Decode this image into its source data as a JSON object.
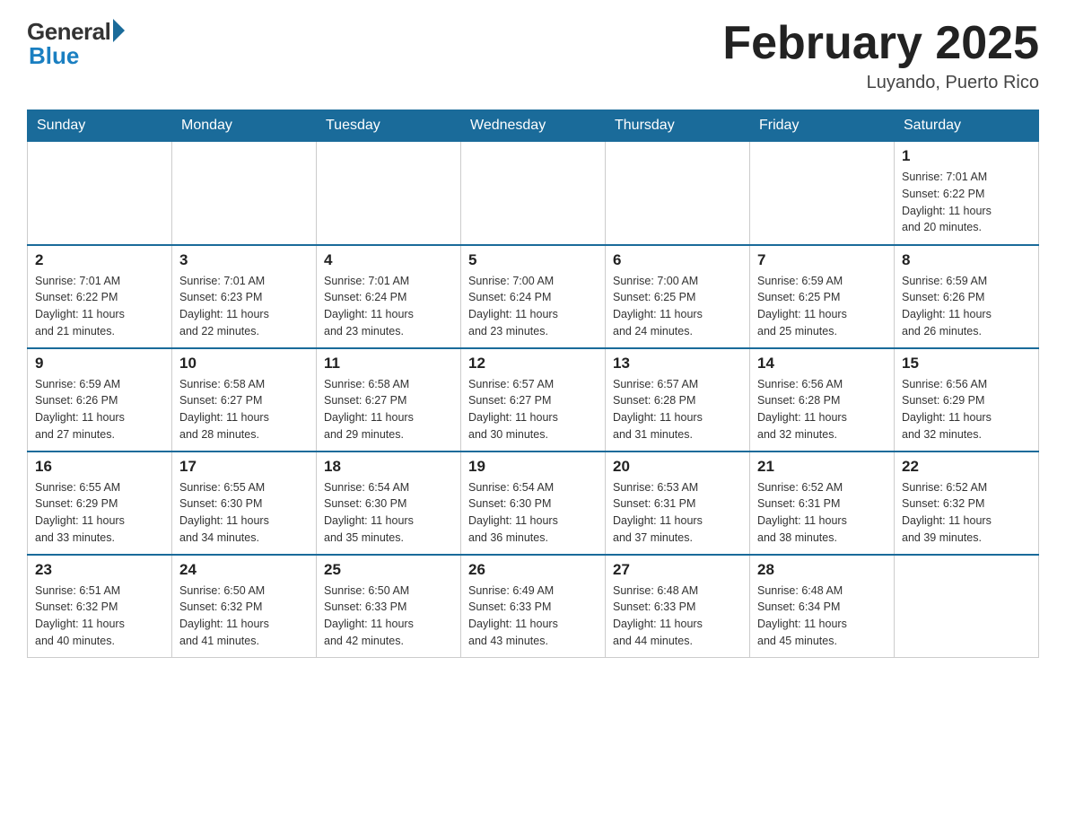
{
  "header": {
    "logo_general": "General",
    "logo_blue": "Blue",
    "month_title": "February 2025",
    "location": "Luyando, Puerto Rico"
  },
  "days_of_week": [
    "Sunday",
    "Monday",
    "Tuesday",
    "Wednesday",
    "Thursday",
    "Friday",
    "Saturday"
  ],
  "weeks": [
    [
      {
        "day": "",
        "info": ""
      },
      {
        "day": "",
        "info": ""
      },
      {
        "day": "",
        "info": ""
      },
      {
        "day": "",
        "info": ""
      },
      {
        "day": "",
        "info": ""
      },
      {
        "day": "",
        "info": ""
      },
      {
        "day": "1",
        "info": "Sunrise: 7:01 AM\nSunset: 6:22 PM\nDaylight: 11 hours\nand 20 minutes."
      }
    ],
    [
      {
        "day": "2",
        "info": "Sunrise: 7:01 AM\nSunset: 6:22 PM\nDaylight: 11 hours\nand 21 minutes."
      },
      {
        "day": "3",
        "info": "Sunrise: 7:01 AM\nSunset: 6:23 PM\nDaylight: 11 hours\nand 22 minutes."
      },
      {
        "day": "4",
        "info": "Sunrise: 7:01 AM\nSunset: 6:24 PM\nDaylight: 11 hours\nand 23 minutes."
      },
      {
        "day": "5",
        "info": "Sunrise: 7:00 AM\nSunset: 6:24 PM\nDaylight: 11 hours\nand 23 minutes."
      },
      {
        "day": "6",
        "info": "Sunrise: 7:00 AM\nSunset: 6:25 PM\nDaylight: 11 hours\nand 24 minutes."
      },
      {
        "day": "7",
        "info": "Sunrise: 6:59 AM\nSunset: 6:25 PM\nDaylight: 11 hours\nand 25 minutes."
      },
      {
        "day": "8",
        "info": "Sunrise: 6:59 AM\nSunset: 6:26 PM\nDaylight: 11 hours\nand 26 minutes."
      }
    ],
    [
      {
        "day": "9",
        "info": "Sunrise: 6:59 AM\nSunset: 6:26 PM\nDaylight: 11 hours\nand 27 minutes."
      },
      {
        "day": "10",
        "info": "Sunrise: 6:58 AM\nSunset: 6:27 PM\nDaylight: 11 hours\nand 28 minutes."
      },
      {
        "day": "11",
        "info": "Sunrise: 6:58 AM\nSunset: 6:27 PM\nDaylight: 11 hours\nand 29 minutes."
      },
      {
        "day": "12",
        "info": "Sunrise: 6:57 AM\nSunset: 6:27 PM\nDaylight: 11 hours\nand 30 minutes."
      },
      {
        "day": "13",
        "info": "Sunrise: 6:57 AM\nSunset: 6:28 PM\nDaylight: 11 hours\nand 31 minutes."
      },
      {
        "day": "14",
        "info": "Sunrise: 6:56 AM\nSunset: 6:28 PM\nDaylight: 11 hours\nand 32 minutes."
      },
      {
        "day": "15",
        "info": "Sunrise: 6:56 AM\nSunset: 6:29 PM\nDaylight: 11 hours\nand 32 minutes."
      }
    ],
    [
      {
        "day": "16",
        "info": "Sunrise: 6:55 AM\nSunset: 6:29 PM\nDaylight: 11 hours\nand 33 minutes."
      },
      {
        "day": "17",
        "info": "Sunrise: 6:55 AM\nSunset: 6:30 PM\nDaylight: 11 hours\nand 34 minutes."
      },
      {
        "day": "18",
        "info": "Sunrise: 6:54 AM\nSunset: 6:30 PM\nDaylight: 11 hours\nand 35 minutes."
      },
      {
        "day": "19",
        "info": "Sunrise: 6:54 AM\nSunset: 6:30 PM\nDaylight: 11 hours\nand 36 minutes."
      },
      {
        "day": "20",
        "info": "Sunrise: 6:53 AM\nSunset: 6:31 PM\nDaylight: 11 hours\nand 37 minutes."
      },
      {
        "day": "21",
        "info": "Sunrise: 6:52 AM\nSunset: 6:31 PM\nDaylight: 11 hours\nand 38 minutes."
      },
      {
        "day": "22",
        "info": "Sunrise: 6:52 AM\nSunset: 6:32 PM\nDaylight: 11 hours\nand 39 minutes."
      }
    ],
    [
      {
        "day": "23",
        "info": "Sunrise: 6:51 AM\nSunset: 6:32 PM\nDaylight: 11 hours\nand 40 minutes."
      },
      {
        "day": "24",
        "info": "Sunrise: 6:50 AM\nSunset: 6:32 PM\nDaylight: 11 hours\nand 41 minutes."
      },
      {
        "day": "25",
        "info": "Sunrise: 6:50 AM\nSunset: 6:33 PM\nDaylight: 11 hours\nand 42 minutes."
      },
      {
        "day": "26",
        "info": "Sunrise: 6:49 AM\nSunset: 6:33 PM\nDaylight: 11 hours\nand 43 minutes."
      },
      {
        "day": "27",
        "info": "Sunrise: 6:48 AM\nSunset: 6:33 PM\nDaylight: 11 hours\nand 44 minutes."
      },
      {
        "day": "28",
        "info": "Sunrise: 6:48 AM\nSunset: 6:34 PM\nDaylight: 11 hours\nand 45 minutes."
      },
      {
        "day": "",
        "info": ""
      }
    ]
  ]
}
